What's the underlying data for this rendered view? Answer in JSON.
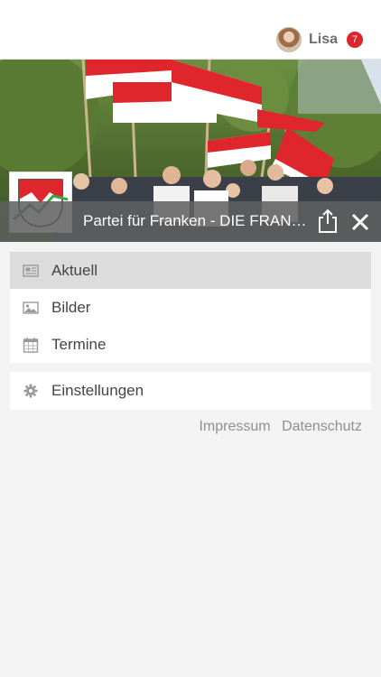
{
  "header": {
    "user_name": "Lisa",
    "notification_count": "7"
  },
  "banner": {
    "title": "Partei für Franken - DIE FRAN…"
  },
  "menu": {
    "items": [
      {
        "label": "Aktuell",
        "icon": "newspaper-icon",
        "active": true
      },
      {
        "label": "Bilder",
        "icon": "image-icon",
        "active": false
      },
      {
        "label": "Termine",
        "icon": "calendar-icon",
        "active": false
      }
    ],
    "settings_label": "Einstellungen"
  },
  "footer": {
    "impressum": "Impressum",
    "datenschutz": "Datenschutz"
  },
  "colors": {
    "accent_red": "#e0242c",
    "bar_gray": "#5f5f5f",
    "active_item": "#dcdcdc"
  }
}
